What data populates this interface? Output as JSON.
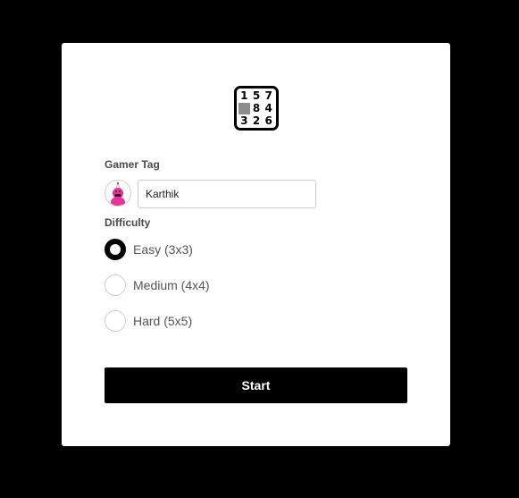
{
  "logo": {
    "cells": [
      "1",
      "5",
      "7",
      "",
      "8",
      "4",
      "3",
      "2",
      "6"
    ],
    "blank_color": "#8c8c8c"
  },
  "gamer_tag": {
    "label": "Gamer Tag",
    "value": "Karthik",
    "avatar_icon": "pink-character-avatar-icon"
  },
  "difficulty": {
    "label": "Difficulty",
    "selected": "easy",
    "options": [
      {
        "id": "easy",
        "label": "Easy (3x3)"
      },
      {
        "id": "medium",
        "label": "Medium (4x4)"
      },
      {
        "id": "hard",
        "label": "Hard (5x5)"
      }
    ]
  },
  "start_button": {
    "label": "Start"
  },
  "colors": {
    "background": "#000000",
    "card": "#ffffff",
    "accent": "#000000",
    "avatar_pink": "#e6339a"
  }
}
